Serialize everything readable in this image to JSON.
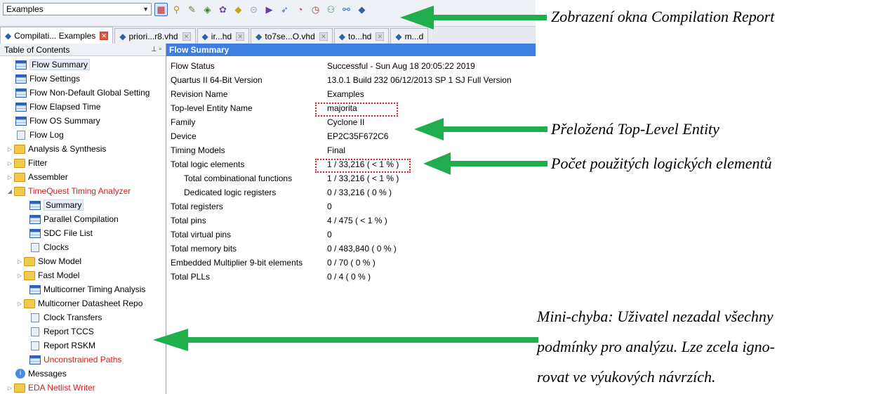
{
  "toolbar": {
    "project_select_value": "Examples",
    "icons": [
      "compilation-report-icon",
      "pin-planner-icon",
      "settings-icon",
      "assignment-icon",
      "chip-icon",
      "lock-icon",
      "stop-icon",
      "start-icon",
      "analysis-icon",
      "timing-icon",
      "timer-icon",
      "netlist-icon",
      "rtl-icon",
      "compile-icon"
    ]
  },
  "tabs": [
    {
      "label": "Compilati... Examples",
      "active": true
    },
    {
      "label": "priori...r8.vhd"
    },
    {
      "label": "ir...hd"
    },
    {
      "label": "to7se...O.vhd"
    },
    {
      "label": "to...hd"
    },
    {
      "label": "m...d"
    }
  ],
  "toc": {
    "title": "Table of Contents",
    "items": [
      {
        "label": "Flow Summary",
        "icon": "table",
        "level": 1,
        "highlight": true
      },
      {
        "label": "Flow Settings",
        "icon": "table",
        "level": 1
      },
      {
        "label": "Flow Non-Default Global Setting",
        "icon": "table",
        "level": 1
      },
      {
        "label": "Flow Elapsed Time",
        "icon": "table",
        "level": 1
      },
      {
        "label": "Flow OS Summary",
        "icon": "table",
        "level": 1
      },
      {
        "label": "Flow Log",
        "icon": "doc",
        "level": 1
      },
      {
        "label": "Analysis & Synthesis",
        "icon": "folder",
        "level": 0,
        "twisty": "closed"
      },
      {
        "label": "Fitter",
        "icon": "folder",
        "level": 0,
        "twisty": "closed"
      },
      {
        "label": "Assembler",
        "icon": "folder",
        "level": 0,
        "twisty": "closed"
      },
      {
        "label": "TimeQuest Timing Analyzer",
        "icon": "folder",
        "level": 0,
        "twisty": "open",
        "red": true
      },
      {
        "label": "Summary",
        "icon": "table",
        "level": 2,
        "highlight": true
      },
      {
        "label": "Parallel Compilation",
        "icon": "table",
        "level": 2
      },
      {
        "label": "SDC File List",
        "icon": "table",
        "level": 2
      },
      {
        "label": "Clocks",
        "icon": "doc",
        "level": 2
      },
      {
        "label": "Slow Model",
        "icon": "folder",
        "level": 1,
        "twisty": "closed"
      },
      {
        "label": "Fast Model",
        "icon": "folder",
        "level": 1,
        "twisty": "closed"
      },
      {
        "label": "Multicorner Timing Analysis",
        "icon": "table",
        "level": 2
      },
      {
        "label": "Multicorner Datasheet Repo",
        "icon": "folder",
        "level": 1,
        "twisty": "closed"
      },
      {
        "label": "Clock Transfers",
        "icon": "doc",
        "level": 2
      },
      {
        "label": "Report TCCS",
        "icon": "doc",
        "level": 2
      },
      {
        "label": "Report RSKM",
        "icon": "doc",
        "level": 2
      },
      {
        "label": "Unconstrained Paths",
        "icon": "table",
        "level": 2,
        "red": true
      },
      {
        "label": "Messages",
        "icon": "info",
        "level": 1
      },
      {
        "label": "EDA Netlist Writer",
        "icon": "folder",
        "level": 0,
        "twisty": "closed",
        "red": true
      }
    ]
  },
  "report": {
    "title": "Flow Summary",
    "rows": [
      {
        "key": "Flow Status",
        "value": "Successful - Sun Aug 18 20:05:22 2019"
      },
      {
        "key": "Quartus II 64-Bit Version",
        "value": "13.0.1 Build 232 06/12/2013 SP 1 SJ Full Version"
      },
      {
        "key": "Revision Name",
        "value": "Examples"
      },
      {
        "key": "Top-level Entity Name",
        "value": "majorita"
      },
      {
        "key": "Family",
        "value": "Cyclone II"
      },
      {
        "key": "Device",
        "value": "EP2C35F672C6"
      },
      {
        "key": "Timing Models",
        "value": "Final"
      },
      {
        "key": "Total logic elements",
        "value": "1 / 33,216 ( < 1 % )"
      },
      {
        "key": "Total combinational functions",
        "value": "1 / 33,216 ( < 1 % )",
        "indent": true
      },
      {
        "key": "Dedicated logic registers",
        "value": "0 / 33,216 ( 0 % )",
        "indent": true
      },
      {
        "key": "Total registers",
        "value": "0"
      },
      {
        "key": "Total pins",
        "value": "4 / 475 ( < 1 % )"
      },
      {
        "key": "Total virtual pins",
        "value": "0"
      },
      {
        "key": "Total memory bits",
        "value": "0 / 483,840 ( 0 % )"
      },
      {
        "key": "Embedded Multiplier 9-bit elements",
        "value": "0 / 70 ( 0 % )"
      },
      {
        "key": "Total PLLs",
        "value": "0 / 4 ( 0 % )"
      }
    ]
  },
  "annotations": {
    "compilation_report": "Zobrazení okna Compilation Report",
    "top_level_entity": "Přeložená Top-Level Entity",
    "logic_elements": "Počet použitých logických elementů",
    "mini_error_line1": "Mini-chyba: Uživatel nezadal všechny",
    "mini_error_line2": "podmínky pro analýzu. Lze zcela igno-",
    "mini_error_line3": "rovat ve výukových návrzích."
  },
  "colors": {
    "arrow": "#1fae4b",
    "report_header": "#3c7fe0",
    "highlight_box": "#e02020",
    "red_text": "#d21e1e"
  }
}
